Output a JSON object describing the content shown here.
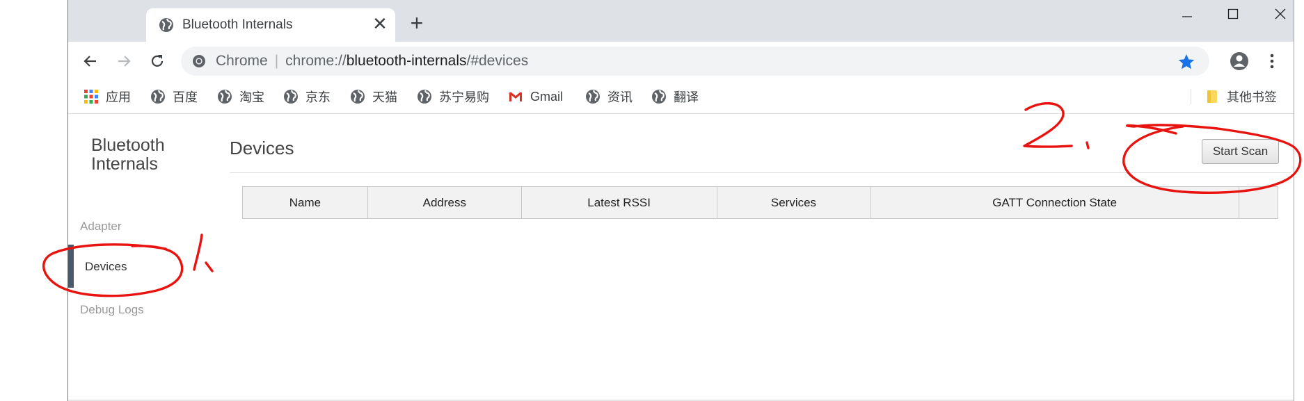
{
  "browser": {
    "tab_title": "Bluetooth Internals",
    "tab_close": "✕",
    "new_tab": "+",
    "url": {
      "chrome_label": "Chrome",
      "separator": "|",
      "scheme": "chrome://",
      "host": "bluetooth-internals",
      "path": "/#devices"
    },
    "bookmarks": [
      {
        "label": "应用",
        "icon": "apps-grid-icon"
      },
      {
        "label": "百度",
        "icon": "globe-icon"
      },
      {
        "label": "淘宝",
        "icon": "globe-icon"
      },
      {
        "label": "京东",
        "icon": "globe-icon"
      },
      {
        "label": "天猫",
        "icon": "globe-icon"
      },
      {
        "label": "苏宁易购",
        "icon": "globe-icon"
      },
      {
        "label": "Gmail",
        "icon": "gmail-icon"
      },
      {
        "label": "资讯",
        "icon": "globe-icon"
      },
      {
        "label": "翻译",
        "icon": "globe-icon"
      }
    ],
    "other_bookmarks": "其他书签",
    "star_color": "#1a73e8"
  },
  "sidebar": {
    "title_line1": "Bluetooth",
    "title_line2": "Internals",
    "items": [
      {
        "label": "Adapter",
        "active": false
      },
      {
        "label": "Devices",
        "active": true
      },
      {
        "label": "Debug Logs",
        "active": false
      }
    ]
  },
  "main": {
    "title": "Devices",
    "scan_button": "Start Scan",
    "table": {
      "columns": [
        "Name",
        "Address",
        "Latest RSSI",
        "Services",
        "GATT Connection State",
        ""
      ]
    }
  },
  "annotations": {
    "color": "#e8130f",
    "labels": [
      "1.",
      "2."
    ]
  }
}
